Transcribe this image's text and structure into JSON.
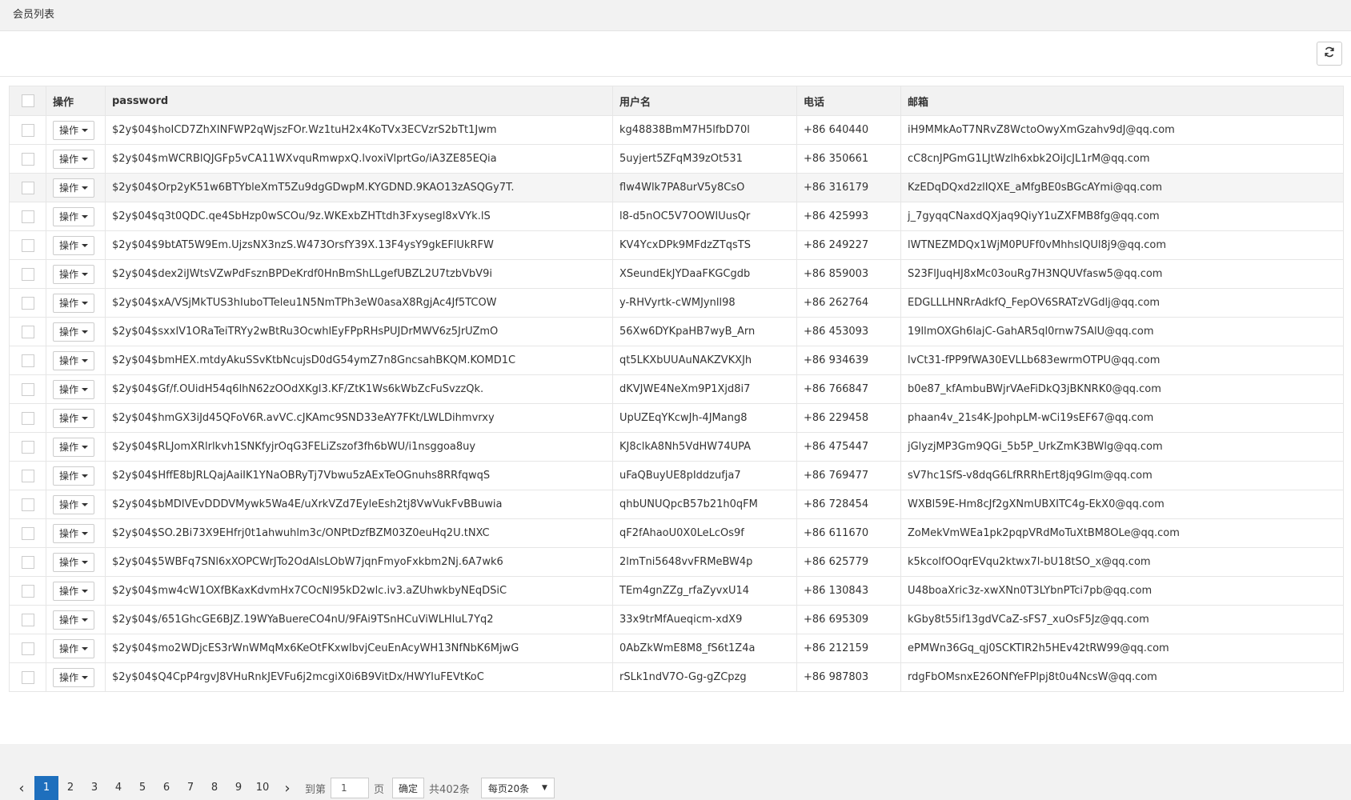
{
  "header": {
    "title": "会员列表"
  },
  "toolbar": {
    "refresh_icon": "refresh-icon"
  },
  "table": {
    "columns": [
      "操作",
      "password",
      "用户名",
      "电话",
      "邮箱"
    ],
    "op_label": "操作",
    "rows": [
      {
        "password": "$2y$04$hoICD7ZhXINFWP2qWjszFOr.Wz1tuH2x4KoTVx3ECVzrS2bTt1Jwm",
        "username": "kg48838BmM7H5lfbD70l",
        "phone": "+86 640440",
        "email": "iH9MMkAoT7NRvZ8WctoOwyXmGzahv9dJ@qq.com"
      },
      {
        "password": "$2y$04$mWCRBlQJGFp5vCA11WXvquRmwpxQ.lvoxiVlprtGo/iA3ZE85EQia",
        "username": "5uyjert5ZFqM39zOt531",
        "phone": "+86 350661",
        "email": "cC8cnJPGmG1LJtWzlh6xbk2OiJcJL1rM@qq.com"
      },
      {
        "password": "$2y$04$Orp2yK51w6BTYbleXmT5Zu9dgGDwpM.KYGDND.9KAO13zASQGy7T.",
        "username": "flw4Wlk7PA8urV5y8CsO",
        "phone": "+86 316179",
        "email": "KzEDqDQxd2zlIQXE_aMfgBE0sBGcAYmi@qq.com"
      },
      {
        "password": "$2y$04$q3t0QDC.qe4SbHzp0wSCOu/9z.WKExbZHTtdh3Fxysegl8xVYk.lS",
        "username": "l8-d5nOC5V7OOWIUusQr",
        "phone": "+86 425993",
        "email": "j_7gyqqCNaxdQXjaq9QiyY1uZXFMB8fg@qq.com"
      },
      {
        "password": "$2y$04$9btAT5W9Em.UjzsNX3nzS.W473OrsfY39X.13F4ysY9gkEFlUkRFW",
        "username": "KV4YcxDPk9MFdzZTqsTS",
        "phone": "+86 249227",
        "email": "lWTNEZMDQx1WjM0PUFf0vMhhslQUl8j9@qq.com"
      },
      {
        "password": "$2y$04$dex2iJWtsVZwPdFsznBPDeKrdf0HnBmShLLgefUBZL2U7tzbVbV9i",
        "username": "XSeundEkJYDaaFKGCgdb",
        "phone": "+86 859003",
        "email": "S23FlJuqHJ8xMc03ouRg7H3NQUVfasw5@qq.com"
      },
      {
        "password": "$2y$04$xA/VSjMkTUS3hIuboTTeleu1N5NmTPh3eW0asaX8RgjAc4Jf5TCOW",
        "username": "y-RHVyrtk-cWMJynll98",
        "phone": "+86 262764",
        "email": "EDGLLLHNRrAdkfQ_FepOV6SRATzVGdlj@qq.com"
      },
      {
        "password": "$2y$04$sxxlV1ORaTeiTRYy2wBtRu3OcwhlEyFPpRHsPUJDrMWV6z5JrUZmO",
        "username": "56Xw6DYKpaHB7wyB_Arn",
        "phone": "+86 453093",
        "email": "19llmOXGh6lajC-GahAR5ql0rnw7SAlU@qq.com"
      },
      {
        "password": "$2y$04$bmHEX.mtdyAkuSSvKtbNcujsD0dG54ymZ7n8GncsahBKQM.KOMD1C",
        "username": "qt5LKXbUUAuNAKZVKXJh",
        "phone": "+86 934639",
        "email": "lvCt31-fPP9fWA30EVLLb683ewrmOTPU@qq.com"
      },
      {
        "password": "$2y$04$Gf/f.OUidH54q6lhN62zOOdXKgl3.KF/ZtK1Ws6kWbZcFuSvzzQk.",
        "username": "dKVJWE4NeXm9P1Xjd8i7",
        "phone": "+86 766847",
        "email": "b0e87_kfAmbuBWjrVAeFiDkQ3jBKNRK0@qq.com"
      },
      {
        "password": "$2y$04$hmGX3iJd45QFoV6R.avVC.cJKAmc9SND33eAY7FKt/LWLDihmvrxy",
        "username": "UpUZEqYKcwJh-4JMang8",
        "phone": "+86 229458",
        "email": "phaan4v_21s4K-JpohpLM-wCi19sEF67@qq.com"
      },
      {
        "password": "$2y$04$RLJomXRlrlkvh1SNKfyjrOqG3FELiZszof3fh6bWU/i1nsggoa8uy",
        "username": "KJ8clkA8Nh5VdHW74UPA",
        "phone": "+86 475447",
        "email": "jGlyzjMP3Gm9QGi_5b5P_UrkZmK3BWlg@qq.com"
      },
      {
        "password": "$2y$04$HffE8bJRLQajAaiIK1YNaOBRyTj7Vbwu5zAExTeOGnuhs8RRfqwqS",
        "username": "uFaQBuyUE8pIddzufja7",
        "phone": "+86 769477",
        "email": "sV7hc1SfS-v8dqG6LfRRRhErt8jq9Glm@qq.com"
      },
      {
        "password": "$2y$04$bMDIVEvDDDVMywk5Wa4E/uXrkVZd7EyleEsh2tj8VwVukFvBBuwia",
        "username": "qhbUNUQpcB57b21h0qFM",
        "phone": "+86 728454",
        "email": "WXBl59E-Hm8cJf2gXNmUBXITC4g-EkX0@qq.com"
      },
      {
        "password": "$2y$04$SO.2Bi73X9EHfrj0t1ahwuhlm3c/ONPtDzfBZM03Z0euHq2U.tNXC",
        "username": "qF2fAhaoU0X0LeLcOs9f",
        "phone": "+86 611670",
        "email": "ZoMekVmWEa1pk2pqpVRdMoTuXtBM8OLe@qq.com"
      },
      {
        "password": "$2y$04$5WBFq7SNl6xXOPCWrJTo2OdAlsLObW7jqnFmyoFxkbm2Nj.6A7wk6",
        "username": "2lmTni5648vvFRMeBW4p",
        "phone": "+86 625779",
        "email": "k5kcolfOOqrEVqu2ktwx7l-bU18tSO_x@qq.com"
      },
      {
        "password": "$2y$04$mw4cW1OXfBKaxKdvmHx7COcNl95kD2wlc.iv3.aZUhwkbyNEqDSiC",
        "username": "TEm4gnZZg_rfaZyvxU14",
        "phone": "+86 130843",
        "email": "U48boaXric3z-xwXNn0T3LYbnPTci7pb@qq.com"
      },
      {
        "password": "$2y$04$/651GhcGE6BJZ.19WYaBuereCO4nU/9FAi9TSnHCuViWLHluL7Yq2",
        "username": "33x9trMfAueqicm-xdX9",
        "phone": "+86 695309",
        "email": "kGby8t55if13gdVCaZ-sFS7_xuOsF5Jz@qq.com"
      },
      {
        "password": "$2y$04$mo2WDjcES3rWnWMqMx6KeOtFKxwlbvjCeuEnAcyWH13NfNbK6MjwG",
        "username": "0AbZkWmE8M8_fS6t1Z4a",
        "phone": "+86 212159",
        "email": "ePMWn36Gq_qj0SCKTIR2h5HEv42tRW99@qq.com"
      },
      {
        "password": "$2y$04$Q4CpP4rgvJ8VHuRnkJEVFu6j2mcgiX0i6B9VitDx/HWYIuFEVtKoC",
        "username": "rSLk1ndV7O-Gg-gZCpzg",
        "phone": "+86 987803",
        "email": "rdgFbOMsnxE26ONfYeFPlpj8t0u4NcsW@qq.com"
      }
    ]
  },
  "pagination": {
    "prev_icon": "chevron-left-icon",
    "next_icon": "chevron-right-icon",
    "pages": [
      "1",
      "2",
      "3",
      "4",
      "5",
      "6",
      "7",
      "8",
      "9",
      "10"
    ],
    "current_page": "1",
    "goto_label": "到第",
    "goto_value": "1",
    "page_suffix": "页",
    "confirm_label": "确定",
    "total_label": "共402条",
    "page_size_label": "每页20条"
  }
}
